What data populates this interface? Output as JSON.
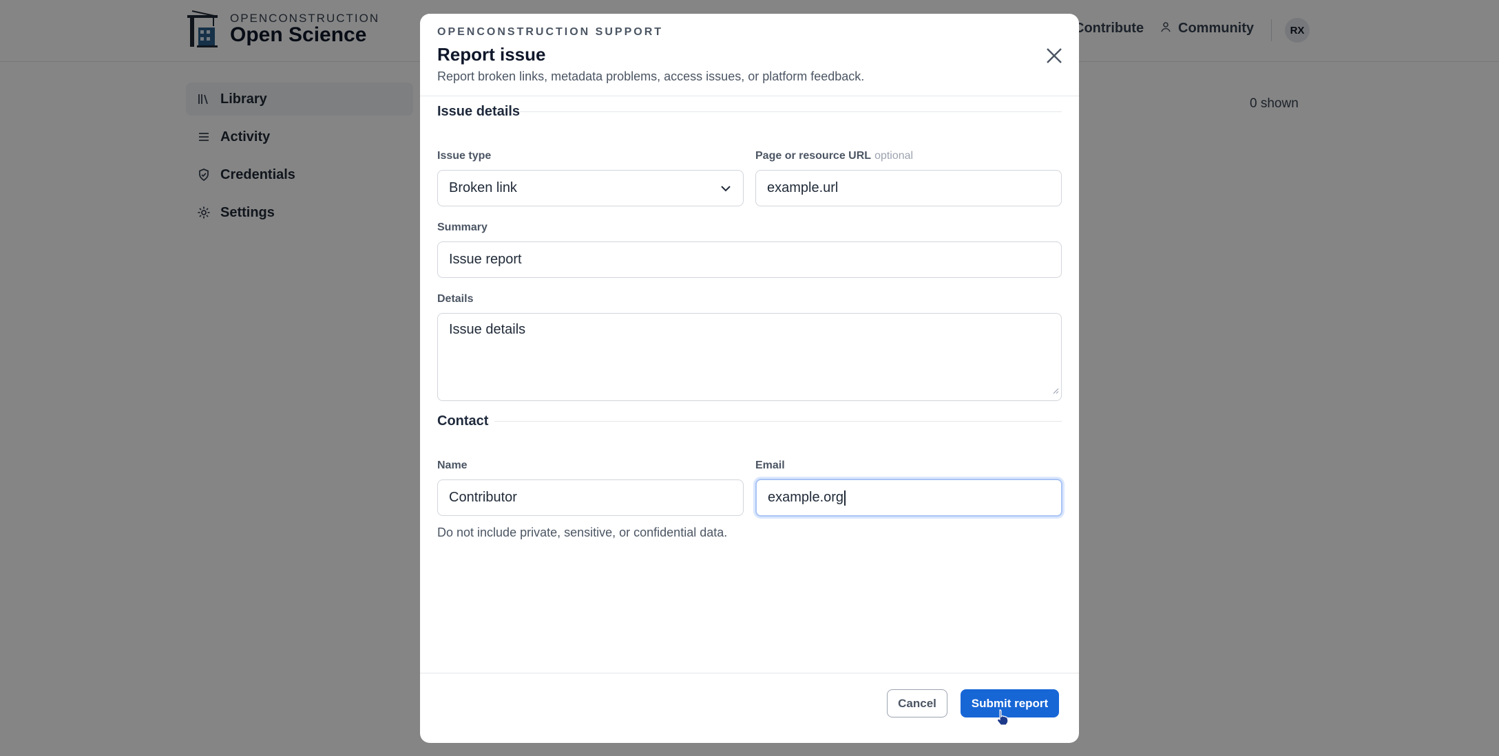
{
  "brand": {
    "top_line": "OPENCONSTRUCTION",
    "name": "Open Science"
  },
  "nav": {
    "contribute": "Contribute",
    "community": "Community",
    "avatar_initials": "RX"
  },
  "sidebar": {
    "items": [
      {
        "label": "Library",
        "icon": "library-icon",
        "active": true
      },
      {
        "label": "Activity",
        "icon": "activity-list-icon"
      },
      {
        "label": "Credentials",
        "icon": "shield-check-icon"
      },
      {
        "label": "Settings",
        "icon": "gear-icon"
      }
    ]
  },
  "main": {
    "shown_count": "0 shown"
  },
  "modal": {
    "eyebrow": "OPENCONSTRUCTION SUPPORT",
    "title": "Report issue",
    "subtitle": "Report broken links, metadata problems, access issues, or platform feedback.",
    "sections": {
      "issue_details": "Issue details",
      "contact": "Contact"
    },
    "fields": {
      "issue_type": {
        "label": "Issue type",
        "value": "Broken link"
      },
      "url": {
        "label": "Page or resource URL",
        "optional": "optional",
        "value": "example.url"
      },
      "summary": {
        "label": "Summary",
        "value": "Issue report"
      },
      "details": {
        "label": "Details",
        "value": "Issue details"
      },
      "name": {
        "label": "Name",
        "value": "Contributor"
      },
      "email": {
        "label": "Email",
        "value": "example.org"
      }
    },
    "note": "Do not include private, sensitive, or confidential data.",
    "cancel_label": "Cancel",
    "submit_label": "Submit report"
  },
  "colors": {
    "primary": "#1766d6",
    "focus_ring": "#a9c4f5",
    "overlay": "rgba(0,0,0,0.48)"
  }
}
